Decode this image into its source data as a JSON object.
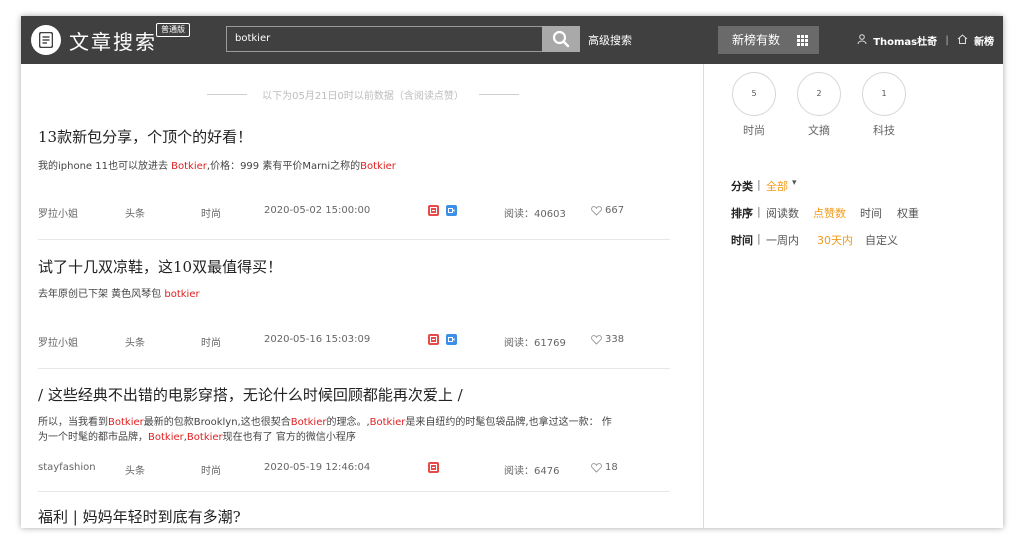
{
  "header": {
    "app_title": "文章搜索",
    "edition_badge": "普通版",
    "search_value": "botkier",
    "advanced_search_label": "高级搜索",
    "new_rank_label": "新榜有数",
    "user_name": "Thomas杜奇",
    "separator": "|",
    "brand_label": "新榜"
  },
  "notice": "以下为05月21日0时以前数据（含阅读点赞）",
  "colors": {
    "highlight": "#e02020",
    "accent": "#f09a1a",
    "header_bg": "#404040"
  },
  "articles": [
    {
      "title": "13款新包分享，个顶个的好看！",
      "snippet": [
        {
          "t": "我的iphone 11也可以放进去 "
        },
        {
          "t": "Botkier",
          "hl": true
        },
        {
          "t": ",价格：999 素有平价Marni之称的"
        },
        {
          "t": "Botkier",
          "hl": true
        }
      ],
      "author": "罗拉小姐",
      "position": "头条",
      "category": "时尚",
      "date": "2020-05-02 15:00:00",
      "badges": [
        "red",
        "blue"
      ],
      "reads": "阅读：40603",
      "likes": "667"
    },
    {
      "title": "试了十几双凉鞋，这10双最值得买！",
      "snippet": [
        {
          "t": "去年原创已下架 黄色风琴包 "
        },
        {
          "t": "botkier",
          "hl": true
        }
      ],
      "author": "罗拉小姐",
      "position": "头条",
      "category": "时尚",
      "date": "2020-05-16 15:03:09",
      "badges": [
        "red",
        "blue"
      ],
      "reads": "阅读：61769",
      "likes": "338"
    },
    {
      "title": "/ 这些经典不出错的电影穿搭，无论什么时候回顾都能再次爱上 /",
      "snippet": [
        {
          "t": "所以，当我看到"
        },
        {
          "t": "Botkier",
          "hl": true
        },
        {
          "t": "最新的包款Brooklyn,这也很契合"
        },
        {
          "t": "Botkier",
          "hl": true
        },
        {
          "t": "的理念。,"
        },
        {
          "t": "Botkier",
          "hl": true
        },
        {
          "t": "是来自纽约的时髦包袋品牌,也拿过这一款：  作为一个时髦的都市品牌，"
        },
        {
          "t": "Botkier",
          "hl": true
        },
        {
          "t": ","
        },
        {
          "t": "Botkier",
          "hl": true
        },
        {
          "t": "现在也有了 官方的微信小程序"
        }
      ],
      "author": "stayfashion",
      "position": "头条",
      "category": "时尚",
      "date": "2020-05-19 12:46:04",
      "badges": [
        "red"
      ],
      "reads": "阅读：6476",
      "likes": "18"
    },
    {
      "title": "福利 | 妈妈年轻时到底有多潮?"
    }
  ],
  "sidebar": {
    "stats": [
      {
        "count": "5",
        "label": "时尚"
      },
      {
        "count": "2",
        "label": "文摘"
      },
      {
        "count": "1",
        "label": "科技"
      }
    ],
    "filters": {
      "category": {
        "key": "分类",
        "sep": "|",
        "value": "全部",
        "arrow": "▾"
      },
      "sort": {
        "key": "排序",
        "sep": "|",
        "options": [
          "阅读数",
          "点赞数",
          "时间",
          "权重"
        ],
        "active": "点赞数"
      },
      "time": {
        "key": "时间",
        "sep": "|",
        "options": [
          "一周内",
          "30天内",
          "自定义"
        ],
        "active": "30天内"
      }
    }
  }
}
